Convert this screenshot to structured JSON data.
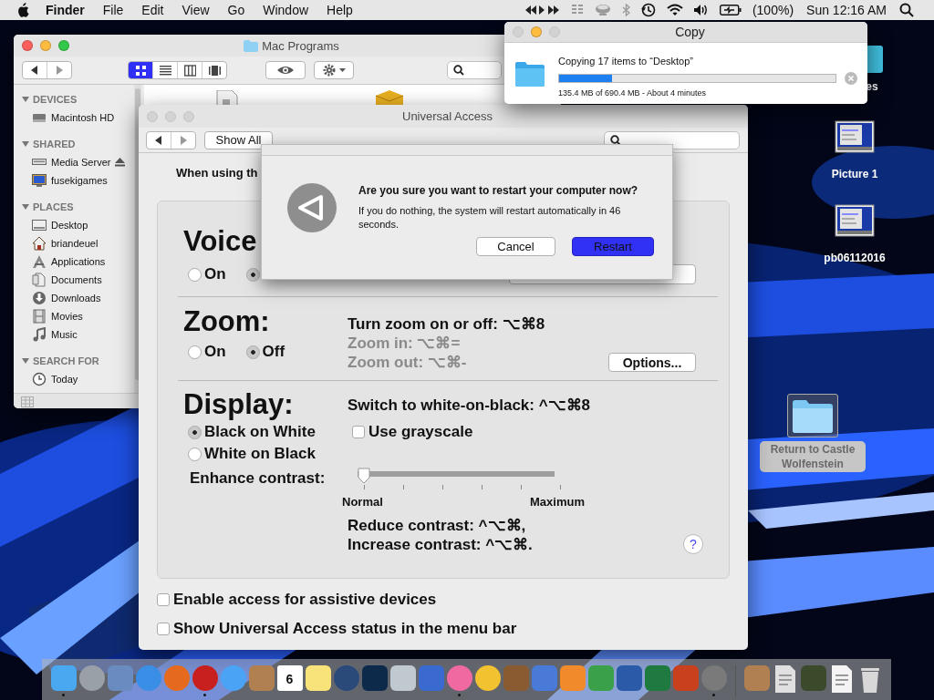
{
  "menu_bar": {
    "app_name": "Finder",
    "menus": [
      "File",
      "Edit",
      "View",
      "Go",
      "Window",
      "Help"
    ],
    "battery": "(100%)",
    "clock": "Sun 12:16 AM"
  },
  "finder_window": {
    "title": "Mac Programs",
    "lights": [
      true,
      true,
      true
    ],
    "view_modes": [
      {
        "selected": true
      },
      {
        "selected": false
      },
      {
        "selected": false
      },
      {
        "selected": false
      }
    ],
    "sidebar": [
      {
        "heading": "DEVICES",
        "expanded": true,
        "items": [
          {
            "label": "Macintosh HD",
            "kind": "drive"
          }
        ]
      },
      {
        "heading": "SHARED",
        "expanded": true,
        "items": [
          {
            "label": "Media Server",
            "kind": "server",
            "ejectable": true
          },
          {
            "label": "fusekigames",
            "kind": "computer"
          }
        ]
      },
      {
        "heading": "PLACES",
        "expanded": true,
        "items": [
          {
            "label": "Desktop",
            "kind": "desktop"
          },
          {
            "label": "briandeuel",
            "kind": "home"
          },
          {
            "label": "Applications",
            "kind": "apps"
          },
          {
            "label": "Documents",
            "kind": "documents"
          },
          {
            "label": "Downloads",
            "kind": "downloads"
          },
          {
            "label": "Movies",
            "kind": "movies"
          },
          {
            "label": "Music",
            "kind": "music"
          }
        ]
      },
      {
        "heading": "SEARCH FOR",
        "expanded": true,
        "items": [
          {
            "label": "Today",
            "kind": "clock"
          }
        ]
      }
    ]
  },
  "prefs_window": {
    "title": "Universal Access",
    "lights": [
      false,
      false,
      false
    ],
    "show_all": "Show All",
    "intro": "When using th",
    "voiceover": {
      "heading": "Voice",
      "options": [
        {
          "label": "On",
          "selected": false
        },
        {
          "selected": true
        }
      ]
    },
    "zoom": {
      "heading": "Zoom:",
      "options": [
        {
          "label": "On",
          "selected": false
        },
        {
          "label": "Off",
          "selected": true
        }
      ],
      "shortcuts": [
        {
          "text": "Turn zoom on or off: ⌥⌘8",
          "disabled": false
        },
        {
          "text": "Zoom in: ⌥⌘=",
          "disabled": true
        },
        {
          "text": "Zoom out: ⌥⌘-",
          "disabled": true
        }
      ],
      "options_button": "Options..."
    },
    "display": {
      "heading": "Display:",
      "shortcut": "Switch to white-on-black: ^⌥⌘8",
      "modes": [
        {
          "label": "Black on White",
          "selected": true
        },
        {
          "label": "White on Black",
          "selected": false
        }
      ],
      "grayscale": {
        "label": "Use grayscale",
        "checked": false
      },
      "contrast": {
        "label": "Enhance contrast:",
        "level": 0,
        "min_label": "Normal",
        "max_label": "Maximum"
      },
      "shortcuts": [
        "Reduce contrast: ^⌥⌘,",
        "Increase contrast: ^⌥⌘."
      ],
      "help": "?"
    },
    "checkboxes": [
      {
        "label": "Enable access for assistive devices",
        "checked": false
      },
      {
        "label": "Show Universal Access status in the menu bar",
        "checked": false
      }
    ]
  },
  "dialog": {
    "title": "Are you sure you want to restart your computer now?",
    "message": "If you do nothing, the system will restart automatically in 46 seconds.",
    "buttons": [
      {
        "label": "Cancel",
        "default": false
      },
      {
        "label": "Restart",
        "default": true
      }
    ]
  },
  "copy_window": {
    "title": "Copy",
    "lights": [
      false,
      true,
      false
    ],
    "status": "Copying 17 items to “Desktop”",
    "progress": {
      "level": 0.19
    },
    "detail": "135.4 MB of 690.4 MB - About 4 minutes"
  },
  "desktop_icons": [
    {
      "label": "es",
      "kind": "app",
      "selected": false
    },
    {
      "label": "Picture 1",
      "kind": "screenshot",
      "selected": false
    },
    {
      "label": "pb06112016",
      "kind": "screenshot",
      "selected": false
    },
    {
      "label": "Return to Castle Wolfenstein",
      "kind": "folder",
      "selected": true
    }
  ],
  "dock": {
    "apps": [
      {
        "kind": "app",
        "color": "#4aa8f0",
        "running": true
      },
      {
        "kind": "round",
        "color": "#9aa0a8",
        "running": false
      },
      {
        "kind": "app",
        "color": "#6a8bc0",
        "running": false
      },
      {
        "kind": "round",
        "color": "#3a8ee6",
        "running": false
      },
      {
        "kind": "round",
        "color": "#e66a1e",
        "running": false
      },
      {
        "kind": "round",
        "color": "#c8201e",
        "running": true
      },
      {
        "kind": "round",
        "color": "#4aa3f5",
        "running": false
      },
      {
        "kind": "app",
        "color": "#b08050",
        "running": false
      },
      {
        "kind": "calendar",
        "color": "#ffffff",
        "text": "6",
        "running": false
      },
      {
        "kind": "app",
        "color": "#f8e27a",
        "running": false
      },
      {
        "kind": "round",
        "color": "#2a4a7a",
        "running": false
      },
      {
        "kind": "app",
        "color": "#0d2a4a",
        "running": false
      },
      {
        "kind": "app",
        "color": "#c0c8d0",
        "running": false
      },
      {
        "kind": "app",
        "color": "#3a6ad0",
        "running": false
      },
      {
        "kind": "round",
        "color": "#f06aa0",
        "running": true
      },
      {
        "kind": "round",
        "color": "#f2c230",
        "running": false
      },
      {
        "kind": "app",
        "color": "#8a5a30",
        "running": false
      },
      {
        "kind": "app",
        "color": "#4a7ad8",
        "running": false
      },
      {
        "kind": "app",
        "color": "#f08a2a",
        "running": false
      },
      {
        "kind": "app",
        "color": "#3aa04a",
        "running": false
      },
      {
        "kind": "app",
        "color": "#2a5aa8",
        "running": false
      },
      {
        "kind": "app",
        "color": "#1e7a3e",
        "running": false
      },
      {
        "kind": "app",
        "color": "#c8401e",
        "running": false
      },
      {
        "kind": "round",
        "color": "#7a7a7a",
        "running": true
      }
    ],
    "others": [
      {
        "kind": "app",
        "color": "#b08050"
      },
      {
        "kind": "document",
        "color": "#e0e0e0"
      },
      {
        "kind": "app",
        "color": "#3a4a2a"
      },
      {
        "kind": "document",
        "color": "#f4f4f4"
      },
      {
        "kind": "trash",
        "color": "#d8d8d8"
      }
    ]
  }
}
